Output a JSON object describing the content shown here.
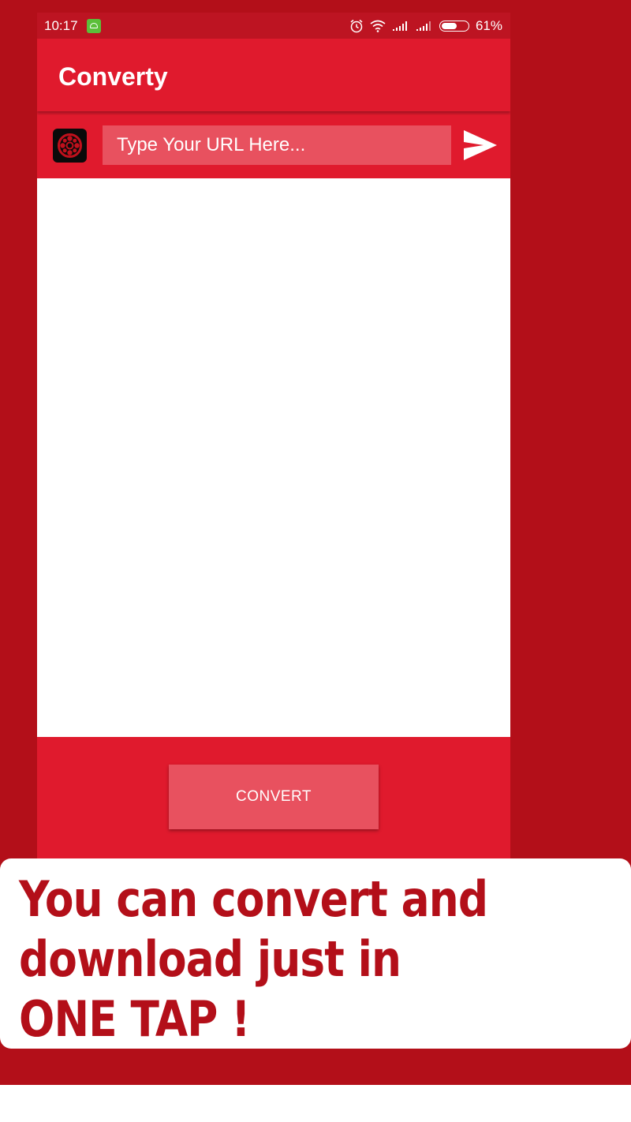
{
  "status_bar": {
    "time": "10:17",
    "battery_percent": "61%",
    "battery_level": 0.61,
    "icons": [
      "android-notification-icon",
      "alarm-icon",
      "wifi-icon",
      "signal-icon",
      "signal-icon",
      "battery-icon"
    ]
  },
  "app": {
    "title": "Converty"
  },
  "url_bar": {
    "placeholder": "Type Your URL Here...",
    "value": "",
    "logo_icon": "film-reel-icon",
    "send_icon": "send-icon"
  },
  "actions": {
    "convert_label": "CONVERT"
  },
  "promo": {
    "line1": "You can convert and",
    "line2": "download just in",
    "line3": "ONE TAP !"
  },
  "colors": {
    "background": "#b30f19",
    "primary": "#e01a2d",
    "primary_dark": "#bd1422",
    "input_fill": "#e8515f",
    "promo_text": "#b30f19"
  }
}
